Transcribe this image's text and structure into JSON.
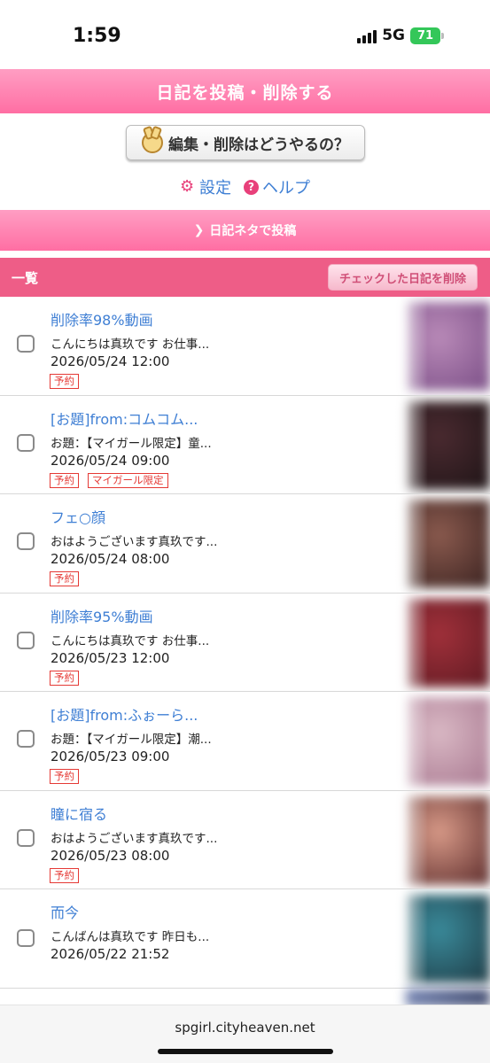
{
  "status": {
    "time": "1:59",
    "network": "5G",
    "battery": "71"
  },
  "header": {
    "title": "日記を投稿・削除する"
  },
  "help": {
    "howto_label": "編集・削除はどうやるの？",
    "settings_label": "設定",
    "help_label": "ヘルプ"
  },
  "neta": {
    "label": "日記ネタで投稿"
  },
  "list": {
    "title": "一覧",
    "delete_checked_label": "チェックした日記を削除"
  },
  "entries": [
    {
      "title": "削除率98%動画",
      "excerpt": "こんにちは真玖です お仕事...",
      "date": "2026/05/24 12:00",
      "tags": [
        "予約"
      ],
      "thumb": [
        "#b98ab8",
        "#7a4e86"
      ]
    },
    {
      "title": "[お題]from:コムコム...",
      "excerpt": "お題：【マイガール限定】童...",
      "date": "2026/05/24 09:00",
      "tags": [
        "予約",
        "マイガール限定"
      ],
      "thumb": [
        "#4a2a30",
        "#1e1416"
      ]
    },
    {
      "title": "フェ○顔",
      "excerpt": "おはようございます真玖です...",
      "date": "2026/05/24 08:00",
      "tags": [
        "予約"
      ],
      "thumb": [
        "#8a5a4e",
        "#3a2220"
      ]
    },
    {
      "title": "削除率95%動画",
      "excerpt": "こんにちは真玖です お仕事...",
      "date": "2026/05/23 12:00",
      "tags": [
        "予約"
      ],
      "thumb": [
        "#a0303a",
        "#5e1a22"
      ]
    },
    {
      "title": "[お題]from:ふぉーら...",
      "excerpt": "お題：【マイガール限定】潮...",
      "date": "2026/05/23 09:00",
      "tags": [
        "予約"
      ],
      "thumb": [
        "#d9b8c4",
        "#a87890"
      ]
    },
    {
      "title": "瞳に宿る",
      "excerpt": "おはようございます真玖です...",
      "date": "2026/05/23 08:00",
      "tags": [
        "予約"
      ],
      "thumb": [
        "#d89a88",
        "#5a2a2a"
      ]
    },
    {
      "title": "而今",
      "excerpt": "こんばんは真玖です 昨日も...",
      "date": "2026/05/22 21:52",
      "tags": [],
      "thumb": [
        "#3a8a9a",
        "#1e3a44"
      ]
    }
  ],
  "browser": {
    "url": "spgirl.cityheaven.net"
  }
}
